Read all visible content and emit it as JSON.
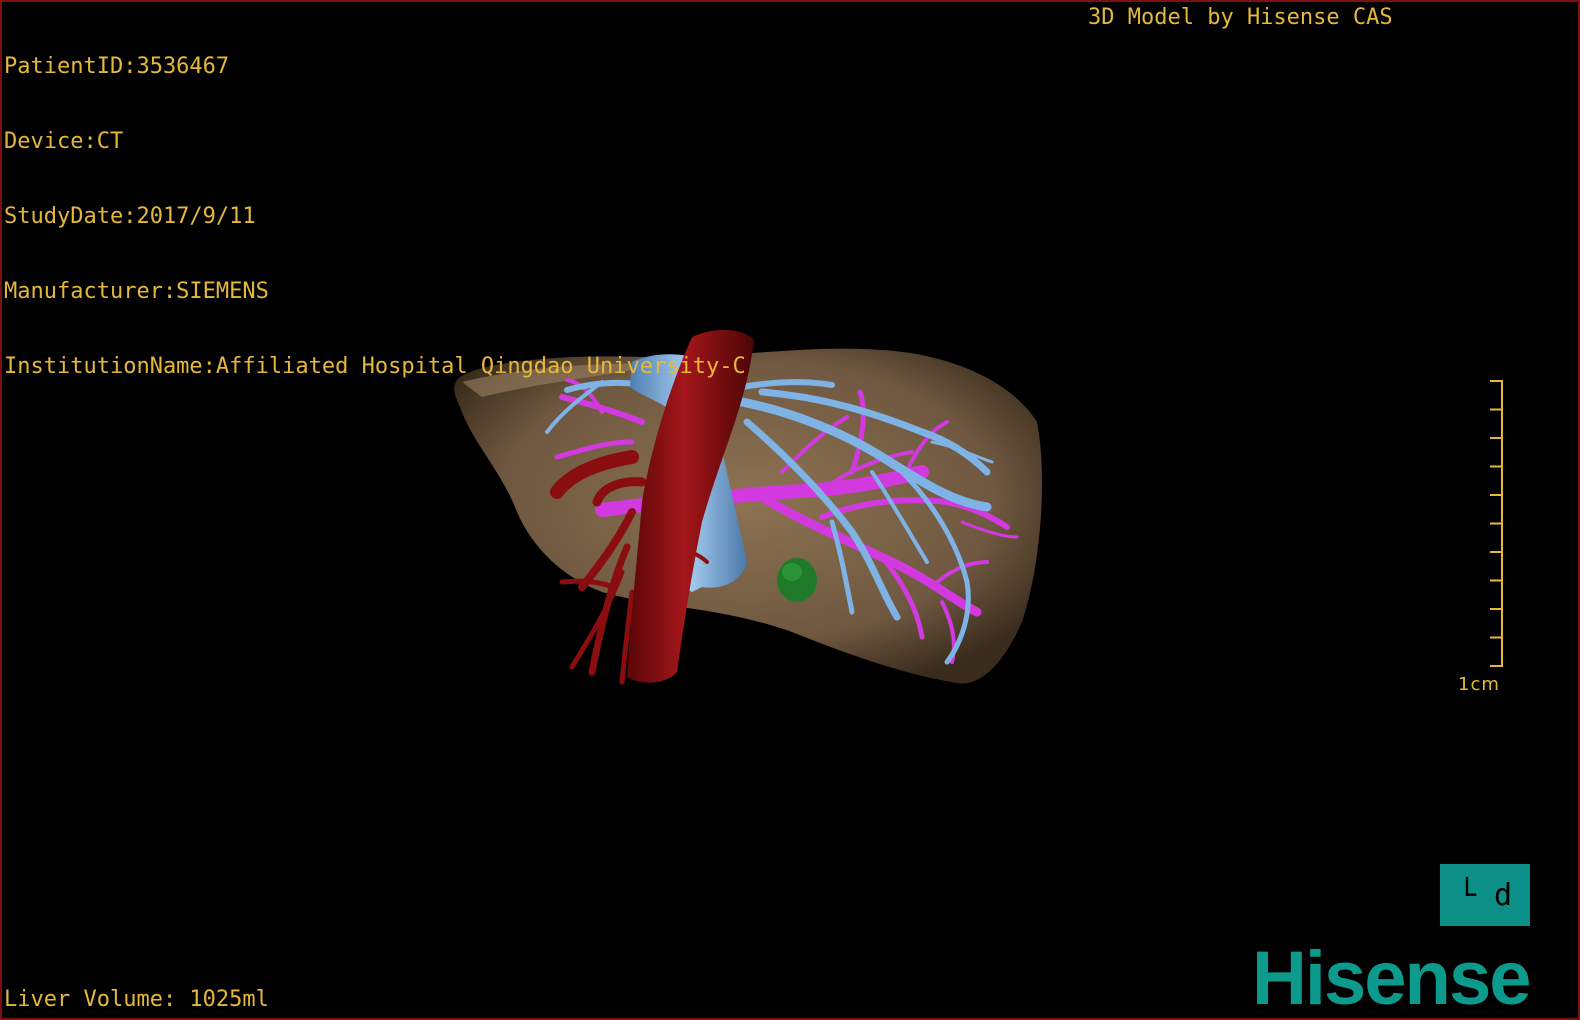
{
  "overlay": {
    "patient_id": "PatientID:3536467",
    "device": "Device:CT",
    "study_date": "StudyDate:2017/9/11",
    "manufacturer": "Manufacturer:SIEMENS",
    "institution": "InstitutionName:Affiliated Hospital Qingdao University-C",
    "model_by": "3D Model by Hisense CAS",
    "liver_volume": "Liver Volume: 1025ml"
  },
  "scale": {
    "label": "1cm",
    "tick_count": 11
  },
  "orientation": {
    "label": "└ d"
  },
  "brand": {
    "name": "Hisense",
    "color": "#0c9a8c"
  },
  "colors": {
    "text": "#e6b83a",
    "liver": "#7d6547",
    "artery": "#8a0e10",
    "hepatic_vein": "#7fb3e6",
    "portal_vein": "#d23adf",
    "lesion": "#1f7a2a",
    "frame": "#7a1010"
  }
}
